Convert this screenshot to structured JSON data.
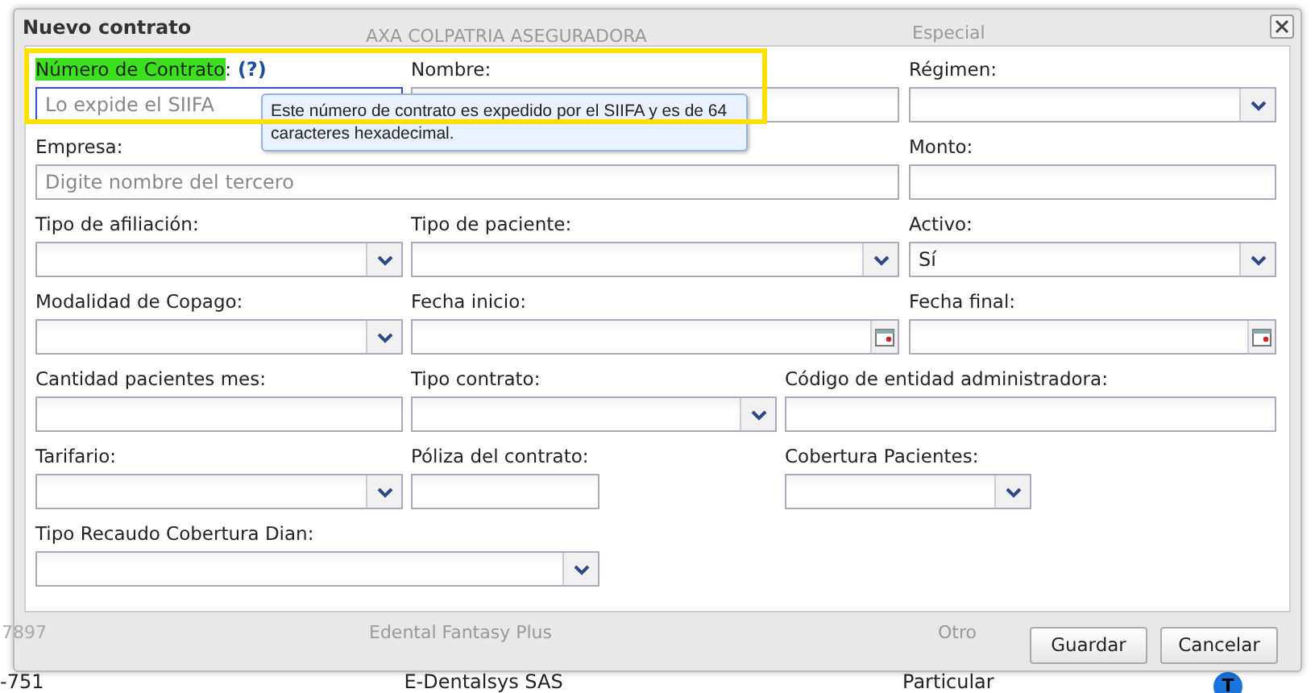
{
  "background_rows": [
    {
      "id": "-751",
      "company": "E-Dentalsys SAS",
      "regime": "Particular",
      "badge": "T"
    }
  ],
  "dialog": {
    "title": "Nuevo contrato",
    "ghost_top": {
      "company": "AXA COLPATRIA ASEGURADORA",
      "regime": "Especial"
    },
    "ghost_bottom": {
      "id": "7897",
      "company": "Edental Fantasy Plus",
      "regime": "Otro"
    },
    "fields": [
      {
        "label": "Número de Contrato",
        "suffix": ":",
        "help": "(?)",
        "highlighted": true,
        "kind": "text",
        "placeholder": "Lo expide el SIIFA",
        "focused": true,
        "tooltip": "Este número de contrato es expedido por el SIIFA y es de 64 caracteres hexadecimal."
      },
      {
        "label": "Nombre:",
        "kind": "text"
      },
      {
        "label": "Régimen:",
        "kind": "select"
      },
      {
        "label": "Empresa:",
        "kind": "text",
        "placeholder": "Digite nombre del tercero"
      },
      {
        "label": "Monto:",
        "kind": "text"
      },
      {
        "label": "Tipo de afiliación:",
        "kind": "select"
      },
      {
        "label": "Tipo de paciente:",
        "kind": "select"
      },
      {
        "label": "Activo:",
        "kind": "select",
        "value": "Sí"
      },
      {
        "label": "Modalidad de Copago:",
        "kind": "select"
      },
      {
        "label": "Fecha inicio:",
        "kind": "date"
      },
      {
        "label": "Fecha final:",
        "kind": "date"
      },
      {
        "label": "Cantidad pacientes mes:",
        "kind": "text"
      },
      {
        "label": "Tipo contrato:",
        "kind": "select"
      },
      {
        "label": "Código de entidad administradora:",
        "kind": "text"
      },
      {
        "label": "Tarifario:",
        "kind": "select"
      },
      {
        "label": "Póliza del contrato:",
        "kind": "text"
      },
      {
        "label": "Cobertura Pacientes:",
        "kind": "select"
      },
      {
        "label": "Tipo Recaudo Cobertura Dian:",
        "kind": "select"
      }
    ],
    "buttons": [
      "Guardar",
      "Cancelar"
    ]
  }
}
